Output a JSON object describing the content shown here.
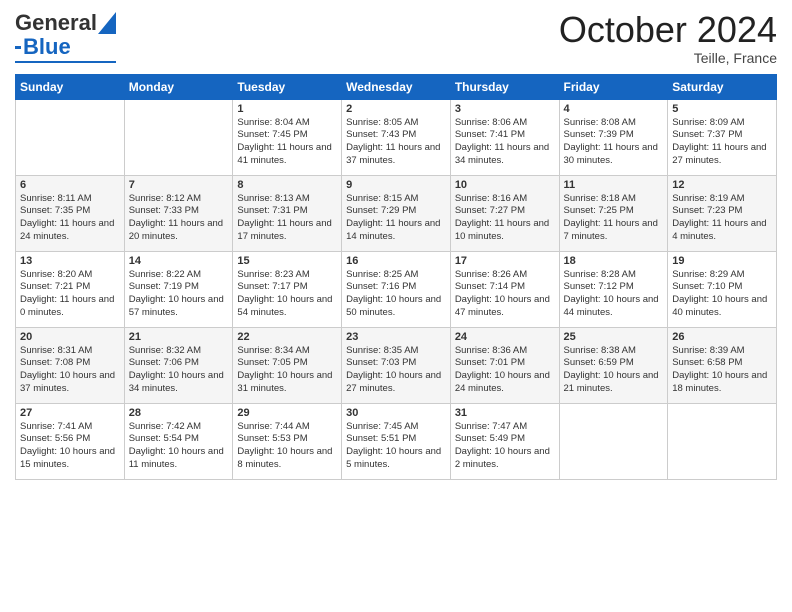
{
  "header": {
    "logo_general": "General",
    "logo_blue": "Blue",
    "month_title": "October 2024",
    "location": "Teille, France"
  },
  "days_of_week": [
    "Sunday",
    "Monday",
    "Tuesday",
    "Wednesday",
    "Thursday",
    "Friday",
    "Saturday"
  ],
  "weeks": [
    [
      {
        "day": "",
        "sunrise": "",
        "sunset": "",
        "daylight": ""
      },
      {
        "day": "",
        "sunrise": "",
        "sunset": "",
        "daylight": ""
      },
      {
        "day": "1",
        "sunrise": "Sunrise: 8:04 AM",
        "sunset": "Sunset: 7:45 PM",
        "daylight": "Daylight: 11 hours and 41 minutes."
      },
      {
        "day": "2",
        "sunrise": "Sunrise: 8:05 AM",
        "sunset": "Sunset: 7:43 PM",
        "daylight": "Daylight: 11 hours and 37 minutes."
      },
      {
        "day": "3",
        "sunrise": "Sunrise: 8:06 AM",
        "sunset": "Sunset: 7:41 PM",
        "daylight": "Daylight: 11 hours and 34 minutes."
      },
      {
        "day": "4",
        "sunrise": "Sunrise: 8:08 AM",
        "sunset": "Sunset: 7:39 PM",
        "daylight": "Daylight: 11 hours and 30 minutes."
      },
      {
        "day": "5",
        "sunrise": "Sunrise: 8:09 AM",
        "sunset": "Sunset: 7:37 PM",
        "daylight": "Daylight: 11 hours and 27 minutes."
      }
    ],
    [
      {
        "day": "6",
        "sunrise": "Sunrise: 8:11 AM",
        "sunset": "Sunset: 7:35 PM",
        "daylight": "Daylight: 11 hours and 24 minutes."
      },
      {
        "day": "7",
        "sunrise": "Sunrise: 8:12 AM",
        "sunset": "Sunset: 7:33 PM",
        "daylight": "Daylight: 11 hours and 20 minutes."
      },
      {
        "day": "8",
        "sunrise": "Sunrise: 8:13 AM",
        "sunset": "Sunset: 7:31 PM",
        "daylight": "Daylight: 11 hours and 17 minutes."
      },
      {
        "day": "9",
        "sunrise": "Sunrise: 8:15 AM",
        "sunset": "Sunset: 7:29 PM",
        "daylight": "Daylight: 11 hours and 14 minutes."
      },
      {
        "day": "10",
        "sunrise": "Sunrise: 8:16 AM",
        "sunset": "Sunset: 7:27 PM",
        "daylight": "Daylight: 11 hours and 10 minutes."
      },
      {
        "day": "11",
        "sunrise": "Sunrise: 8:18 AM",
        "sunset": "Sunset: 7:25 PM",
        "daylight": "Daylight: 11 hours and 7 minutes."
      },
      {
        "day": "12",
        "sunrise": "Sunrise: 8:19 AM",
        "sunset": "Sunset: 7:23 PM",
        "daylight": "Daylight: 11 hours and 4 minutes."
      }
    ],
    [
      {
        "day": "13",
        "sunrise": "Sunrise: 8:20 AM",
        "sunset": "Sunset: 7:21 PM",
        "daylight": "Daylight: 11 hours and 0 minutes."
      },
      {
        "day": "14",
        "sunrise": "Sunrise: 8:22 AM",
        "sunset": "Sunset: 7:19 PM",
        "daylight": "Daylight: 10 hours and 57 minutes."
      },
      {
        "day": "15",
        "sunrise": "Sunrise: 8:23 AM",
        "sunset": "Sunset: 7:17 PM",
        "daylight": "Daylight: 10 hours and 54 minutes."
      },
      {
        "day": "16",
        "sunrise": "Sunrise: 8:25 AM",
        "sunset": "Sunset: 7:16 PM",
        "daylight": "Daylight: 10 hours and 50 minutes."
      },
      {
        "day": "17",
        "sunrise": "Sunrise: 8:26 AM",
        "sunset": "Sunset: 7:14 PM",
        "daylight": "Daylight: 10 hours and 47 minutes."
      },
      {
        "day": "18",
        "sunrise": "Sunrise: 8:28 AM",
        "sunset": "Sunset: 7:12 PM",
        "daylight": "Daylight: 10 hours and 44 minutes."
      },
      {
        "day": "19",
        "sunrise": "Sunrise: 8:29 AM",
        "sunset": "Sunset: 7:10 PM",
        "daylight": "Daylight: 10 hours and 40 minutes."
      }
    ],
    [
      {
        "day": "20",
        "sunrise": "Sunrise: 8:31 AM",
        "sunset": "Sunset: 7:08 PM",
        "daylight": "Daylight: 10 hours and 37 minutes."
      },
      {
        "day": "21",
        "sunrise": "Sunrise: 8:32 AM",
        "sunset": "Sunset: 7:06 PM",
        "daylight": "Daylight: 10 hours and 34 minutes."
      },
      {
        "day": "22",
        "sunrise": "Sunrise: 8:34 AM",
        "sunset": "Sunset: 7:05 PM",
        "daylight": "Daylight: 10 hours and 31 minutes."
      },
      {
        "day": "23",
        "sunrise": "Sunrise: 8:35 AM",
        "sunset": "Sunset: 7:03 PM",
        "daylight": "Daylight: 10 hours and 27 minutes."
      },
      {
        "day": "24",
        "sunrise": "Sunrise: 8:36 AM",
        "sunset": "Sunset: 7:01 PM",
        "daylight": "Daylight: 10 hours and 24 minutes."
      },
      {
        "day": "25",
        "sunrise": "Sunrise: 8:38 AM",
        "sunset": "Sunset: 6:59 PM",
        "daylight": "Daylight: 10 hours and 21 minutes."
      },
      {
        "day": "26",
        "sunrise": "Sunrise: 8:39 AM",
        "sunset": "Sunset: 6:58 PM",
        "daylight": "Daylight: 10 hours and 18 minutes."
      }
    ],
    [
      {
        "day": "27",
        "sunrise": "Sunrise: 7:41 AM",
        "sunset": "Sunset: 5:56 PM",
        "daylight": "Daylight: 10 hours and 15 minutes."
      },
      {
        "day": "28",
        "sunrise": "Sunrise: 7:42 AM",
        "sunset": "Sunset: 5:54 PM",
        "daylight": "Daylight: 10 hours and 11 minutes."
      },
      {
        "day": "29",
        "sunrise": "Sunrise: 7:44 AM",
        "sunset": "Sunset: 5:53 PM",
        "daylight": "Daylight: 10 hours and 8 minutes."
      },
      {
        "day": "30",
        "sunrise": "Sunrise: 7:45 AM",
        "sunset": "Sunset: 5:51 PM",
        "daylight": "Daylight: 10 hours and 5 minutes."
      },
      {
        "day": "31",
        "sunrise": "Sunrise: 7:47 AM",
        "sunset": "Sunset: 5:49 PM",
        "daylight": "Daylight: 10 hours and 2 minutes."
      },
      {
        "day": "",
        "sunrise": "",
        "sunset": "",
        "daylight": ""
      },
      {
        "day": "",
        "sunrise": "",
        "sunset": "",
        "daylight": ""
      }
    ]
  ]
}
